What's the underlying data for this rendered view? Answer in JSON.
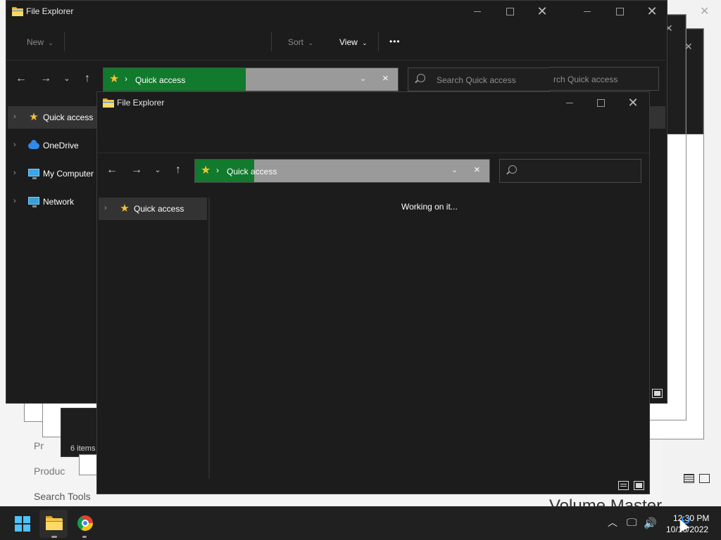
{
  "colors": {
    "accent": "#117a2c",
    "window_bg": "#1c1c1c",
    "taskbar_bg": "#202020",
    "star": "#f2c230"
  },
  "desktop": {
    "texts": [
      "Pr",
      "Produc",
      "Search Tools",
      "Volume Master"
    ],
    "status_items": "6 items"
  },
  "window_back": {
    "title": "File Explorer",
    "commandbar": {
      "new_label": "New",
      "sort_label": "Sort",
      "view_label": "View",
      "more_label": "•••"
    },
    "address": {
      "location": "Quick access",
      "progress": 0.47
    },
    "search": {
      "placeholder": "Search Quick access"
    },
    "nav_pane": [
      {
        "label": "Quick access",
        "icon": "star-icon"
      },
      {
        "label": "OneDrive",
        "icon": "cloud-icon"
      },
      {
        "label": "My Computer",
        "icon": "computer-icon"
      },
      {
        "label": "Network",
        "icon": "network-icon"
      }
    ]
  },
  "window_behind2": {
    "search_placeholder": "rch Quick access"
  },
  "window_front": {
    "title": "File Explorer",
    "address": {
      "location": "Quick access",
      "progress": 0.2
    },
    "search": {
      "placeholder": ""
    },
    "nav_pane": [
      {
        "label": "Quick access",
        "icon": "star-icon"
      }
    ],
    "content_status": "Working on it..."
  },
  "taskbar": {
    "time": "12:30 PM",
    "date": "10/16/2022",
    "icons": [
      "start-icon",
      "file-explorer-icon",
      "chrome-icon"
    ],
    "tray": [
      "chevron-up-icon",
      "network-icon",
      "volume-icon"
    ]
  }
}
